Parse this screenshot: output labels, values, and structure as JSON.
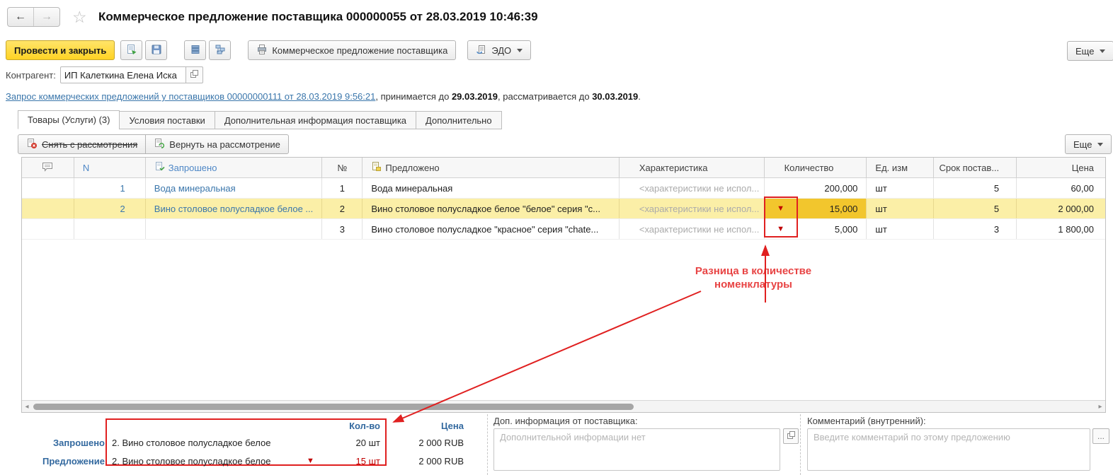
{
  "window": {
    "title": "Коммерческое предложение поставщика 000000055 от 28.03.2019 10:46:39",
    "back_glyph": "←",
    "forward_glyph": "→",
    "star_glyph": "☆"
  },
  "toolbar": {
    "post_and_close": "Провести и закрыть",
    "print_offer": "Коммерческое предложение поставщика",
    "edo": "ЭДО",
    "more": "Еще"
  },
  "contragent": {
    "label": "Контрагент:",
    "value": "ИП Калеткина Елена Иска"
  },
  "request": {
    "link": "Запрос коммерческих предложений у поставщиков 00000000111 от 28.03.2019 9:56:21",
    "accept_prefix": ", принимается до ",
    "accept_date": "29.03.2019",
    "review_prefix": ", рассматривается до ",
    "review_date": "30.03.2019",
    "dot": "."
  },
  "tabs": [
    {
      "label": "Товары (Услуги) (3)",
      "active": true
    },
    {
      "label": "Условия поставки",
      "active": false
    },
    {
      "label": "Дополнительная информация поставщика",
      "active": false
    },
    {
      "label": "Дополнительно",
      "active": false
    }
  ],
  "commands": {
    "remove": "Снять с рассмотрения",
    "restore": "Вернуть на рассмотрение",
    "more": "Еще"
  },
  "table": {
    "columns": {
      "n": "N",
      "requested": "Запрошено",
      "num": "№",
      "offered": "Предложено",
      "characteristic": "Характеристика",
      "qty": "Количество",
      "unit": "Ед. изм",
      "term": "Срок постав...",
      "price": "Цена"
    },
    "rows": [
      {
        "n": "1",
        "requested": "Вода минеральная",
        "num": "1",
        "offered": "Вода минеральная",
        "characteristic": "<характеристики не испол...",
        "qty": "200,000",
        "unit": "шт",
        "term": "5",
        "price": "60,00"
      },
      {
        "n": "2",
        "requested": "Вино столовое полусладкое белое ...",
        "num": "2",
        "offered": "Вино столовое полусладкое белое \"белое\" серия \"с...",
        "characteristic": "<характеристики не испол...",
        "marker": "▼",
        "qty": "15,000",
        "unit": "шт",
        "term": "5",
        "price": "2 000,00"
      },
      {
        "n": "",
        "requested": "",
        "num": "3",
        "offered": "Вино столовое полусладкое \"красное\" серия \"chate...",
        "characteristic": "<характеристики не испол...",
        "marker": "▼",
        "qty": "5,000",
        "unit": "шт",
        "term": "3",
        "price": "1 800,00"
      }
    ]
  },
  "annotation": {
    "line1": "Разница в количестве",
    "line2": "номенклатуры"
  },
  "summary": {
    "qty_header": "Кол-во",
    "price_header": "Цена",
    "rows": [
      {
        "label": "Запрошено",
        "item": "2. Вино столовое полусладкое белое",
        "qty": "20 шт",
        "price": "2 000 RUB"
      },
      {
        "label": "Предложение",
        "item": "2. Вино столовое полусладкое белое",
        "marker": "▼",
        "qty": "15 шт",
        "price": "2 000 RUB"
      }
    ]
  },
  "supplier_info": {
    "label": "Доп. информация от поставщика:",
    "placeholder": "Дополнительной информации нет"
  },
  "internal_comment": {
    "label": "Комментарий (внутренний):",
    "placeholder": "Введите комментарий по этому предложению",
    "more_glyph": "..."
  },
  "scrollbar": {
    "left_glyph": "◂",
    "right_glyph": "▸"
  },
  "colors": {
    "accent_blue": "#33699f",
    "link_blue": "#3a76ab",
    "row_highlight": "#fbefa7",
    "qty_highlight": "#f2c62d",
    "alert_red": "#e02020",
    "value_red": "#c00000",
    "button_yellow": "#ffd324"
  }
}
